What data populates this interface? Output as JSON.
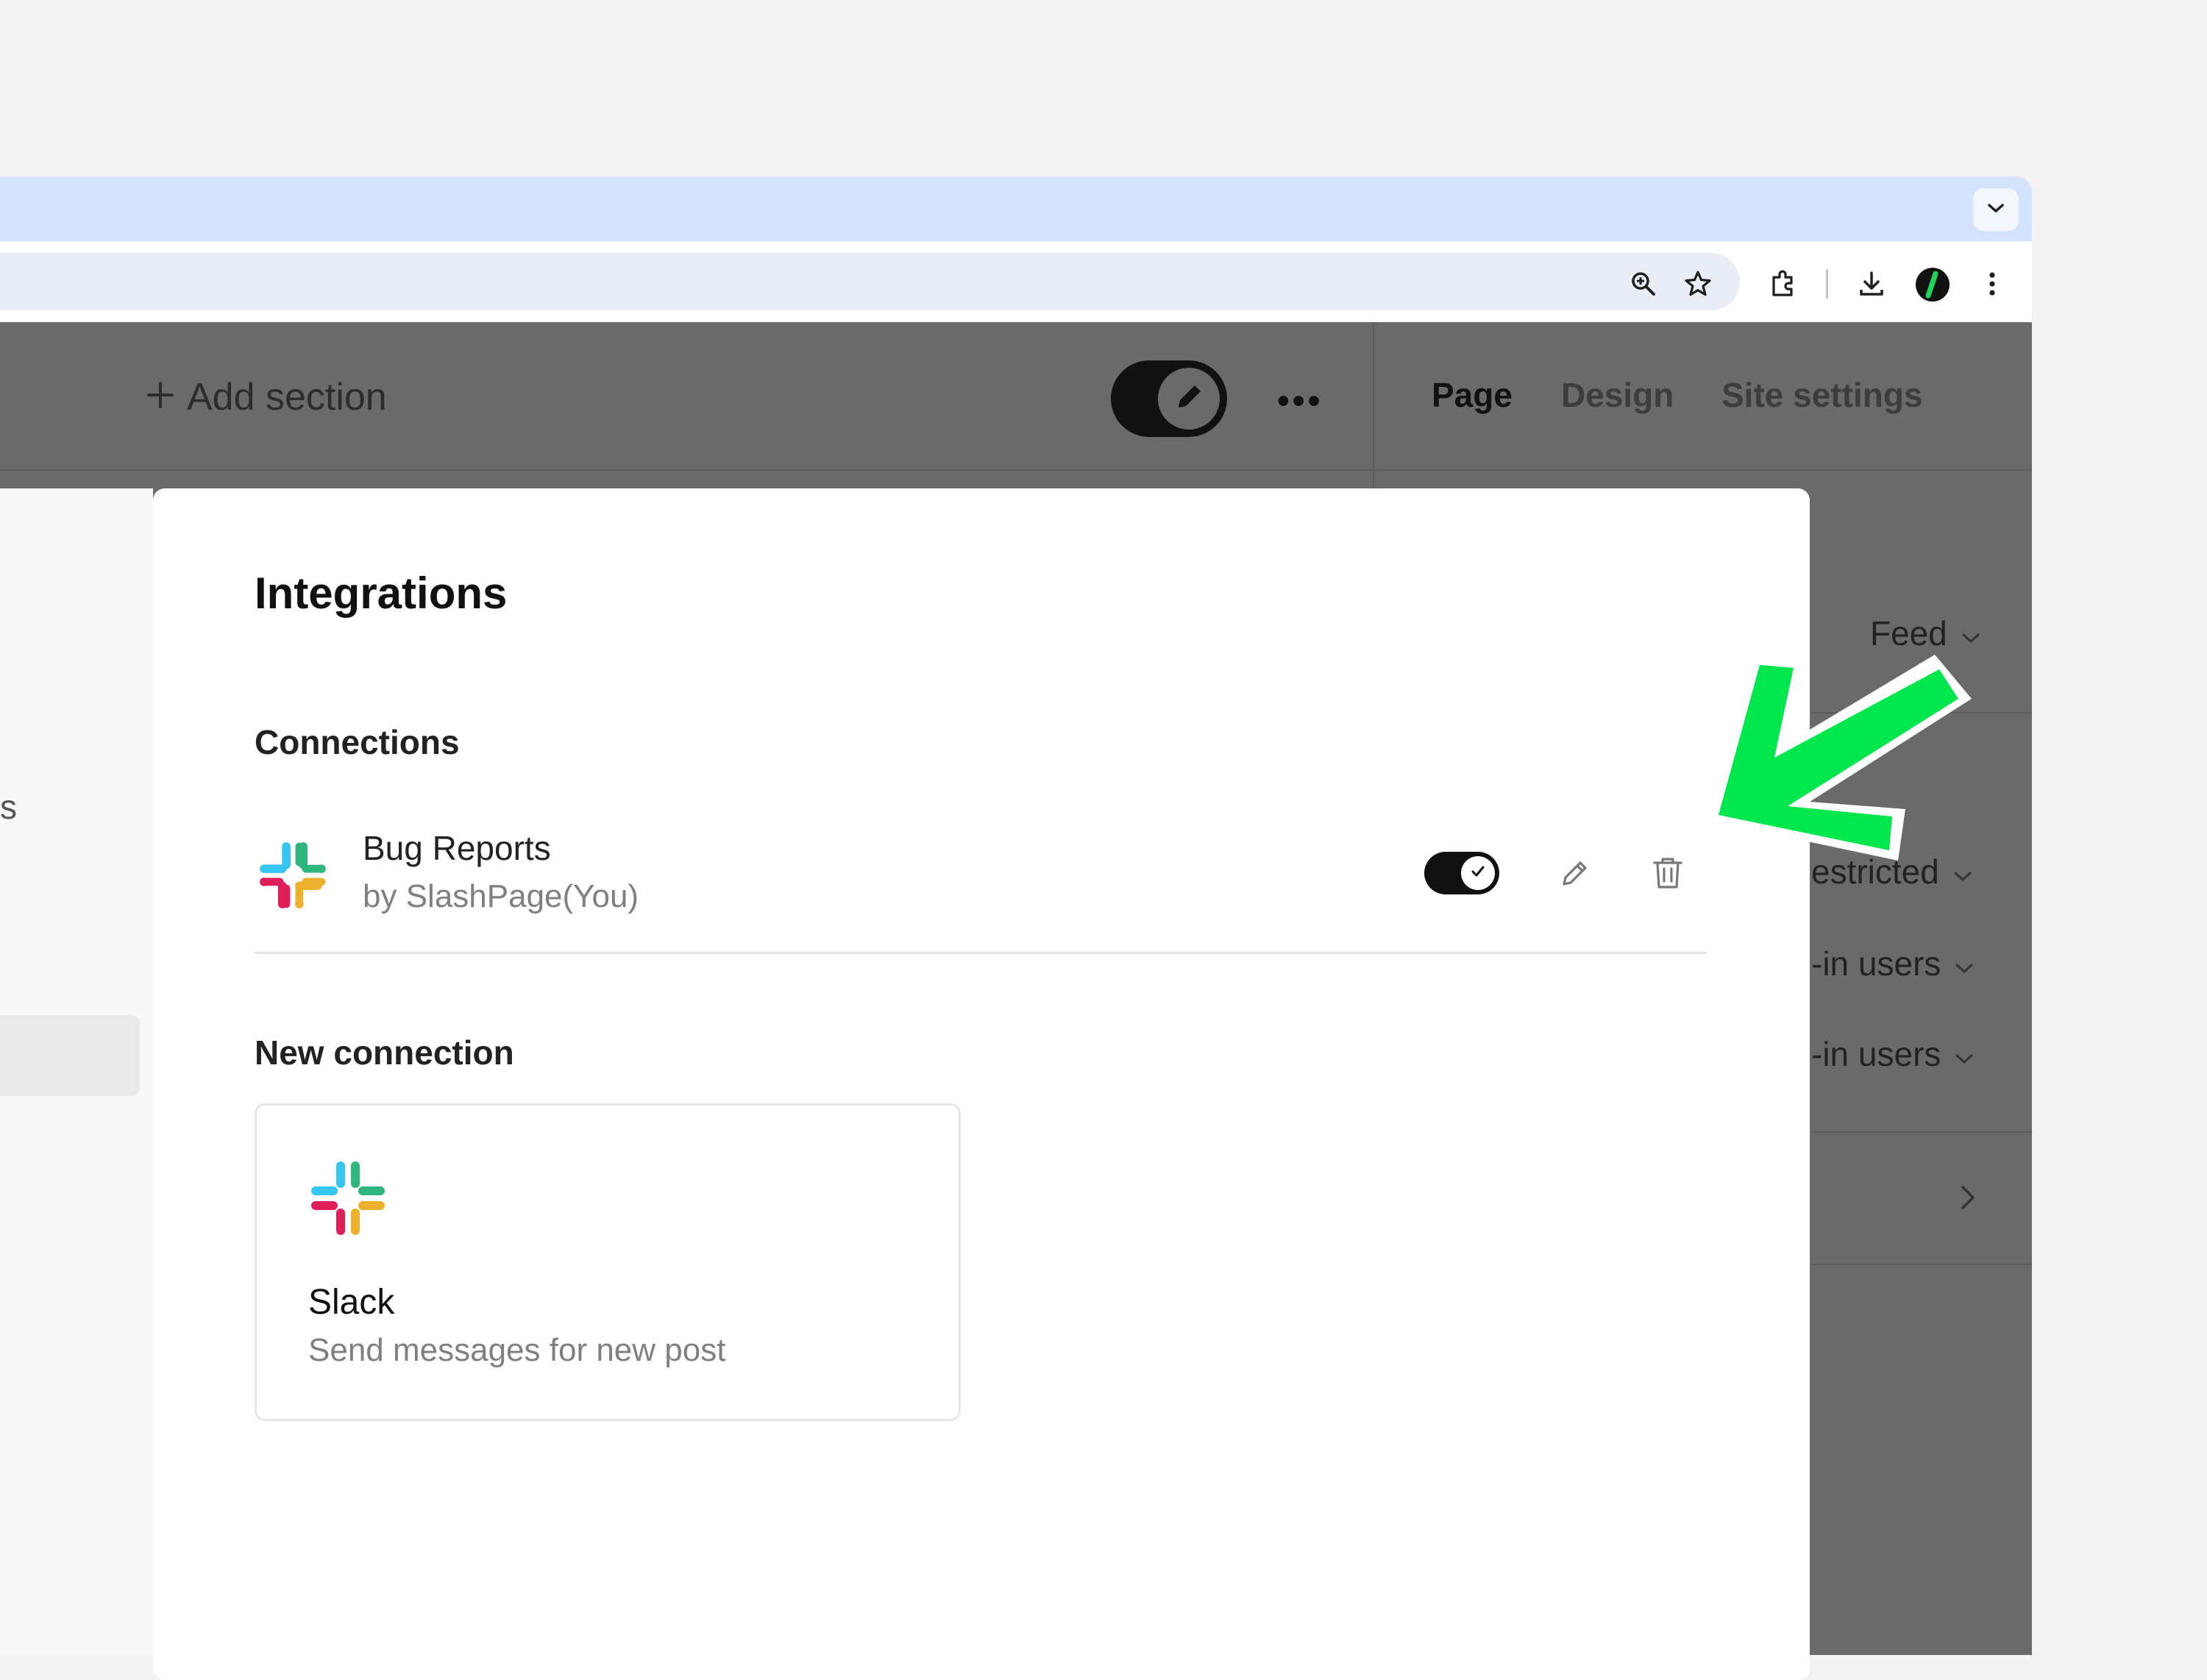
{
  "editor": {
    "add_section_label": "Add section",
    "more_label": "•••"
  },
  "right_panel": {
    "tabs": [
      {
        "label": "Page",
        "active": true
      },
      {
        "label": "Design",
        "active": false
      },
      {
        "label": "Site settings",
        "active": false
      }
    ],
    "rows": [
      {
        "label": "Feed"
      },
      {
        "label": "estricted"
      },
      {
        "label": "-in users"
      },
      {
        "label": "-in users"
      }
    ]
  },
  "left_peek": {
    "text": "s"
  },
  "modal": {
    "title": "Integrations",
    "connections_heading": "Connections",
    "connection": {
      "name": "Bug Reports",
      "owner": "by SlashPage(You)",
      "enabled": true
    },
    "new_connection_heading": "New connection",
    "card": {
      "title": "Slack",
      "description": "Send messages for new post"
    }
  },
  "colors": {
    "tabstrip": "#d3e3fd",
    "overlay": "#6a6a6a",
    "arrow": "#00e64d",
    "slack_blue": "#36c5f0",
    "slack_green": "#2eb67d",
    "slack_red": "#e01e5a",
    "slack_yellow": "#ecb22e"
  }
}
